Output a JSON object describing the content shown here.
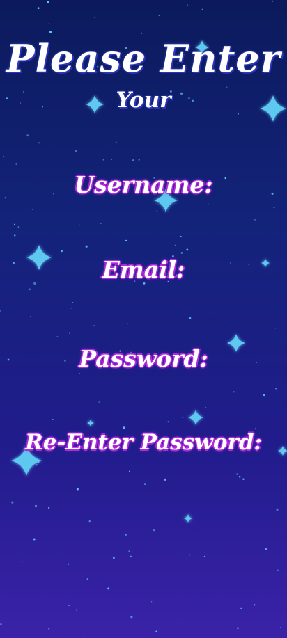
{
  "title": {
    "line1": "Please Enter",
    "line2": "Your"
  },
  "form": {
    "username_label": "Username:",
    "email_label": "Email:",
    "password_label": "Password:",
    "reenter_password_label": "Re-Enter Password:"
  },
  "colors": {
    "background_top": "#0c1a5c",
    "background_bottom": "#3a22a8",
    "star": "#5ec8f0",
    "label_outline": "#b02ad8",
    "text": "#ffffff"
  },
  "icons": [
    "sparkle-star-icon"
  ]
}
